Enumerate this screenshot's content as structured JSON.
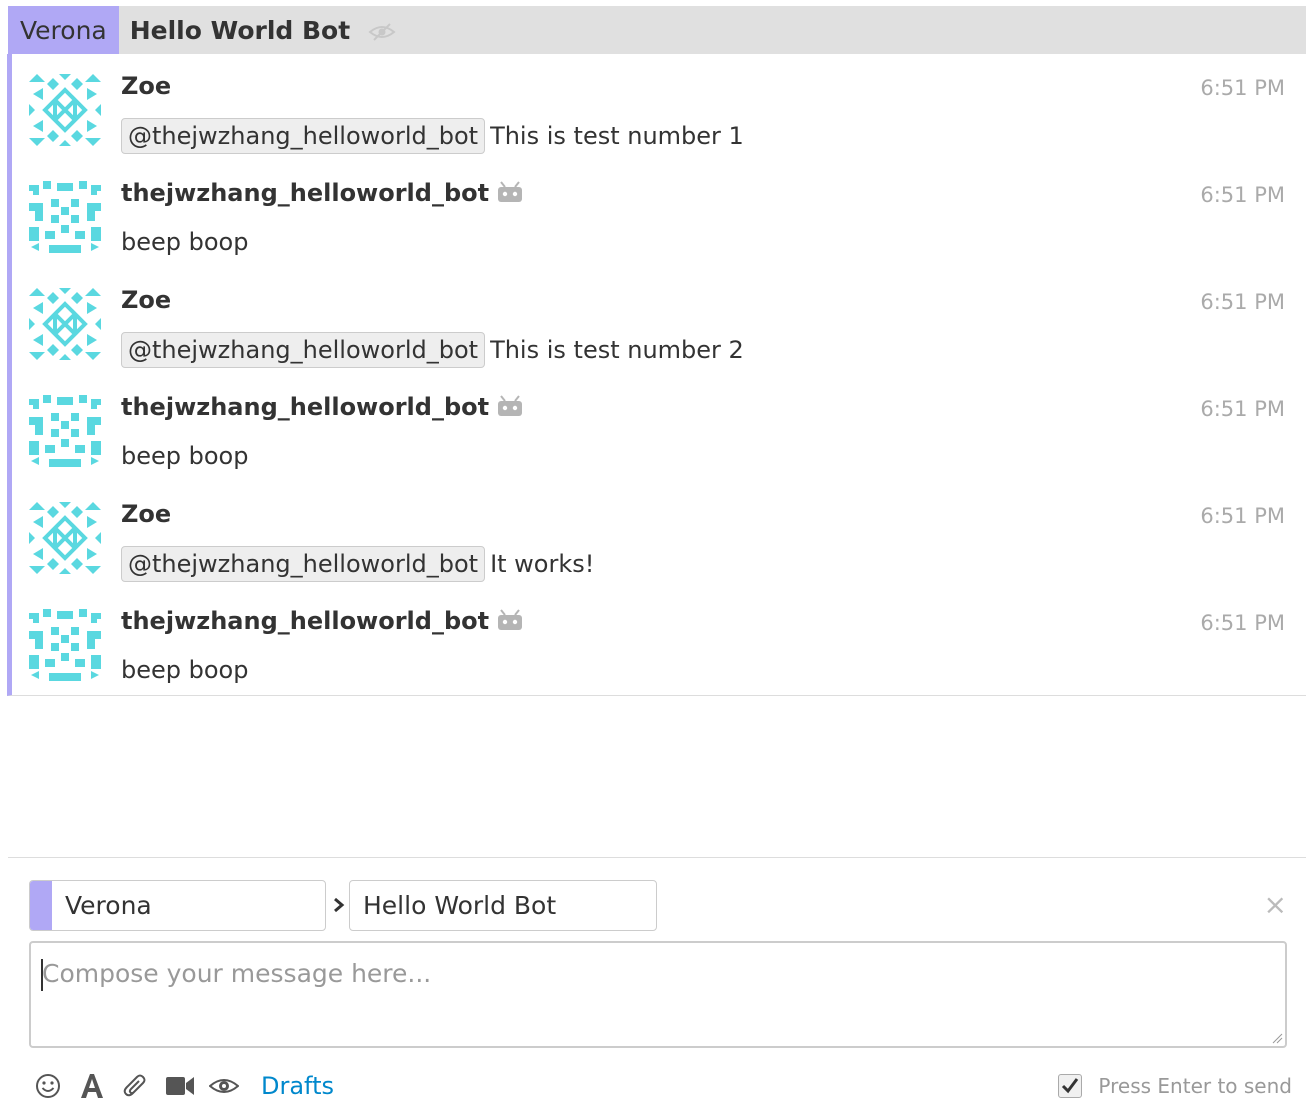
{
  "recipient_bar": {
    "stream": "Verona",
    "topic": "Hello World Bot",
    "topic_icon": "eye-slash-icon"
  },
  "messages": [
    {
      "sender": "Zoe",
      "is_bot": false,
      "time": "6:51 PM",
      "mention": "@thejwzhang_helloworld_bot",
      "text": "This is test number 1",
      "avatar": "avatar-zoe"
    },
    {
      "sender": "thejwzhang_helloworld_bot",
      "is_bot": true,
      "time": "6:51 PM",
      "mention": "",
      "text": "beep boop",
      "avatar": "avatar-bot"
    },
    {
      "sender": "Zoe",
      "is_bot": false,
      "time": "6:51 PM",
      "mention": "@thejwzhang_helloworld_bot",
      "text": "This is test number 2",
      "avatar": "avatar-zoe"
    },
    {
      "sender": "thejwzhang_helloworld_bot",
      "is_bot": true,
      "time": "6:51 PM",
      "mention": "",
      "text": "beep boop",
      "avatar": "avatar-bot"
    },
    {
      "sender": "Zoe",
      "is_bot": false,
      "time": "6:51 PM",
      "mention": "@thejwzhang_helloworld_bot",
      "text": "It works!",
      "avatar": "avatar-zoe"
    },
    {
      "sender": "thejwzhang_helloworld_bot",
      "is_bot": true,
      "time": "6:51 PM",
      "mention": "",
      "text": "beep boop",
      "avatar": "avatar-bot"
    }
  ],
  "compose": {
    "stream_value": "Verona",
    "topic_value": "Hello World Bot",
    "placeholder": "Compose your message here...",
    "close_symbol": "×",
    "drafts_label": "Drafts",
    "enter_to_send_label": "Press Enter to send",
    "enter_to_send_checked": true,
    "toolbar_icons": [
      "smile-icon",
      "format-text-icon",
      "paperclip-icon",
      "video-icon",
      "eye-icon"
    ]
  },
  "colors": {
    "stream": "#b0a8f5",
    "avatar": "#5ad8e0",
    "link": "#0088cc",
    "recipient_bar_bg": "#e0e0e0"
  }
}
